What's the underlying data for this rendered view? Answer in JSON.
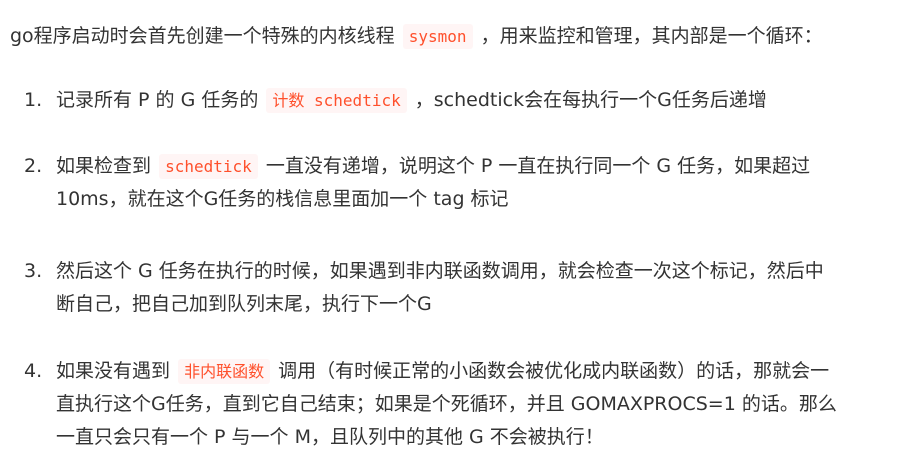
{
  "intro": {
    "before": "go程序启动时会首先创建一个特殊的内核线程",
    "code": "sysmon",
    "after": "，用来监控和管理，其内部是一个循环："
  },
  "items": [
    {
      "number": "1.",
      "before": "记录所有 P 的 G 任务的",
      "code": "计数 schedtick",
      "after": "，schedtick会在每执行一个G任务后递增"
    },
    {
      "number": "2.",
      "before": "如果检查到",
      "code": "schedtick",
      "after_line1": "一直没有递增，说明这个 P 一直在执行同一个 G 任务，如果超过",
      "line2": "10ms，就在这个G任务的栈信息里面加一个 tag 标记"
    },
    {
      "number": "3.",
      "line1": "然后这个 G 任务在执行的时候，如果遇到非内联函数调用，就会检查一次这个标记，然后中",
      "line2": "断自己，把自己加到队列末尾，执行下一个G"
    },
    {
      "number": "4.",
      "before": "如果没有遇到",
      "code": "非内联函数",
      "after_line1": "调用（有时候正常的小函数会被优化成内联函数）的话，那就会一",
      "line2": "直执行这个G任务，直到它自己结束；如果是个死循环，并且 GOMAXPROCS=1 的话。那么",
      "line3": "一直只会只有一个 P 与一个 M，且队列中的其他 G 不会被执行！"
    }
  ]
}
